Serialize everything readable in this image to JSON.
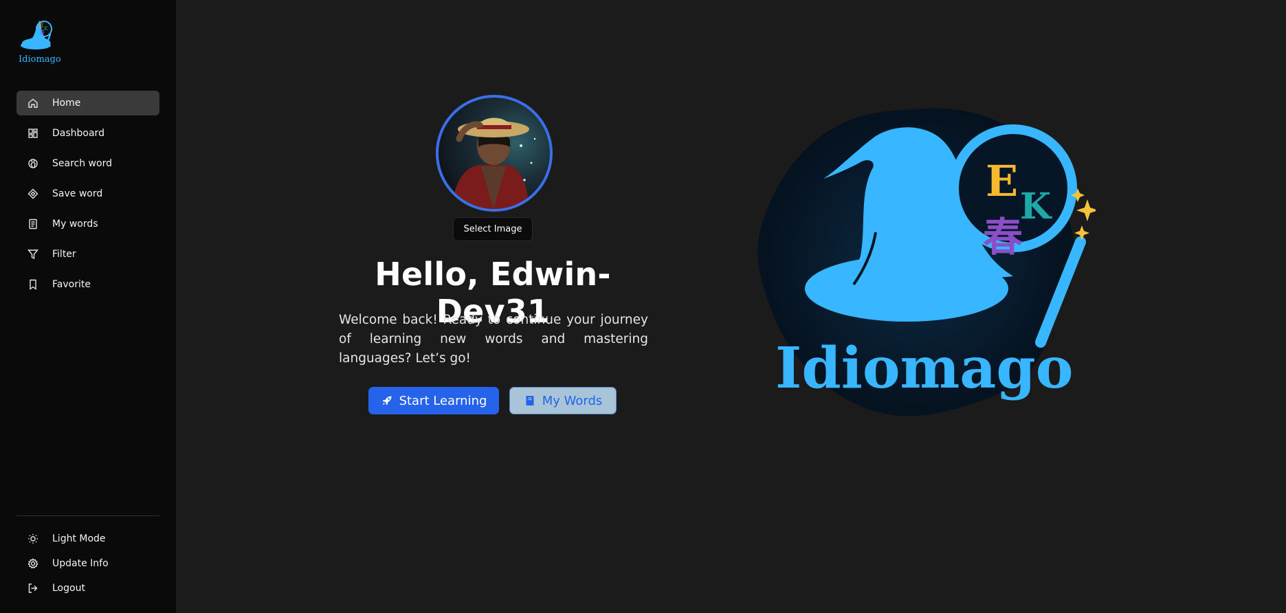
{
  "app": {
    "logo_text": "Idiomago"
  },
  "sidebar": {
    "items": [
      {
        "label": "Home",
        "icon": "home-icon"
      },
      {
        "label": "Dashboard",
        "icon": "dashboard-icon"
      },
      {
        "label": "Search word",
        "icon": "globe-icon"
      },
      {
        "label": "Save word",
        "icon": "diamond-icon"
      },
      {
        "label": "My words",
        "icon": "document-icon"
      },
      {
        "label": "Filter",
        "icon": "filter-icon"
      },
      {
        "label": "Favorite",
        "icon": "bookmark-icon"
      }
    ],
    "bottom": [
      {
        "label": "Light Mode",
        "icon": "sun-icon"
      },
      {
        "label": "Update Info",
        "icon": "gear-icon"
      },
      {
        "label": "Logout",
        "icon": "logout-icon"
      }
    ]
  },
  "profile": {
    "select_image_label": "Select Image",
    "greeting": "Hello, Edwin-Dev31",
    "welcome": "Welcome back! Ready to continue your journey of learning new words and mastering languages? Let’s go!"
  },
  "actions": {
    "start_learning": "Start Learning",
    "my_words": "My Words"
  },
  "colors": {
    "accent": "#2563eb",
    "brand": "#38b6ff",
    "sidebar_bg": "#0a0a0a",
    "main_bg": "#1b1b1b"
  }
}
